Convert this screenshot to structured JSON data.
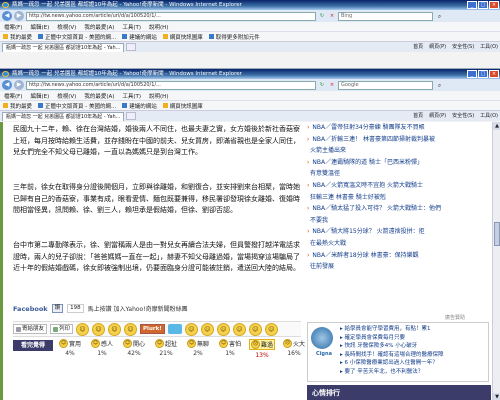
{
  "window1": {
    "title": "瓶媽一疏忽 一起 兒恙園區 都認證10年為起 - Yahoo!奇摩新聞 - Windows Internet Explorer",
    "address": "http://tw.news.yahoo.com/article/url/d/a/100520/1/...",
    "search_placeholder": "Bing",
    "menu": [
      "檔案(F)",
      "編輯(E)",
      "檢視(V)",
      "我的最愛(A)",
      "工具(T)",
      "說明(H)"
    ],
    "favorites": [
      {
        "label": "我的最愛"
      },
      {
        "label": "正體中文版首頁 - 美國的網..."
      },
      {
        "label": "建議的網站"
      },
      {
        "label": "網頁快訊圖庫"
      },
      {
        "label": "取得更多附加元件"
      }
    ],
    "tab_label": "瓶媽一疏忽 一起 兒恙園區 都認證10年為起 - Yah...",
    "tools": [
      "首頁",
      "網頁(P)",
      "安全性(S)",
      "工具(O)"
    ]
  },
  "window2": {
    "title": "瓶媽一疏忽 一起 兒恙園區 都認證10年為起 - Yahoo!奇摩新聞 - Windows Internet Explorer",
    "address": "http://tw.news.yahoo.com/article/url/d/a/100520/1/...",
    "search_placeholder": "Google",
    "tab_label": "瓶媽一疏忽 一起 兒恙園區 都認證10年為起 - Yah..."
  },
  "article": {
    "paragraphs": [
      "民國九十二年，賴、徐在台灣結婚，婚後兩人不同住，也最夫妻之實，女方婚後於新社香菇寮上班，每月按時給賴生活費，並存錢盼在中國的前夫、兒女買房，即滿省親也是全家人同住，兒女們完全不知父母已離婚，一直以為媽媽只是到台灣工作。",
      "三年前，徐女在取得身分證後開個月，立即與徐離婚，和劉復合，並安排劉來台相聚，當時她已歸有自己的香菇寮，事業有成，眼看愛情、麵包既要兼得，移民署卻發現徐女離婚、復婚時間相當怪異，訊問賴、徐、劉三人，賴坦承是假結婚，但徐、劉卻否認。",
      "台中市第二專勤隊表示，徐、劉當稱兩人是由一對兒女再續合法夫婦，但員警撥打越洋電話求證時，兩人的兒子卻說：「爸爸媽媽一直在一起」，赫妻不知父母離過婚，當場揭穿這場騙局了近十年的假結婚戲碼，徐女即被強制出境，仍要面臨身分證可能被註銷，遣送回大陸的結局。"
    ],
    "facebook": {
      "logo": "Facebook",
      "like": "讚",
      "count": "198",
      "join_text": "馬上按讚 加入Yahoo!奇摩新聞粉絲團"
    },
    "actions": [
      "寄給朋友",
      "列印"
    ],
    "plurk": "Plurk!",
    "mood_title": "看完覺得",
    "moods": [
      {
        "label": "實用",
        "icon": "face-useful-icon",
        "pct": "4%"
      },
      {
        "label": "感人",
        "icon": "face-touched-icon",
        "pct": "1%"
      },
      {
        "label": "開心",
        "icon": "face-happy-icon",
        "pct": "42%"
      },
      {
        "label": "超扯",
        "icon": "face-absurd-icon",
        "pct": "21%"
      },
      {
        "label": "無聊",
        "icon": "face-bored-icon",
        "pct": "2%"
      },
      {
        "label": "害怕",
        "icon": "face-scared-icon",
        "pct": "1%"
      },
      {
        "label": "難過",
        "icon": "face-sad-icon",
        "pct": "13%"
      },
      {
        "label": "火大",
        "icon": "face-angry-icon",
        "pct": "16%"
      }
    ]
  },
  "sidebar": {
    "news": [
      "NBA／雷帝狂射34分豪練  騎團隊友不買帳",
      "NBA／折輸三連！ 林書豪第四節掃射裁判暴被",
      "火箭主播出來",
      "NBA／連霸騎隊的道  騎士「巴西米粉彈」",
      "有意雙溫徑",
      "NBA／火箭寬溫文時不宜抱  火箭大戰騎士",
      "狂輸三連 林書豪 騎士好被剋",
      "NBA／騎太猛了投入可待？  火箭大戰騎士：他們",
      "不要我 ",
      "NBA／騎大將15分球？  火箭遠捨投拼：拒",
      "在最熱火大戰",
      "NBA／米醉者18分球  林書豪：保持樂觀",
      "往前發展"
    ],
    "ad_label": "廣告贊助",
    "ad_logo_text": "Cigna",
    "ad_lines": [
      "▸ 給學員會能守學習費用，有點！累1",
      "▸ 確定學員會保費每月只要  ",
      "▸ 快訊 牙醫保險多4% 小心破牙",
      "",
      "▸ 長時間找手！確認有這場合理的醫療保障",
      "▸ 6 小保險醫療業認出過入住醫開一年？",
      "▸ 要了 辛苦天年北，也不利醫法？"
    ],
    "mood_rank": "心情排行"
  }
}
